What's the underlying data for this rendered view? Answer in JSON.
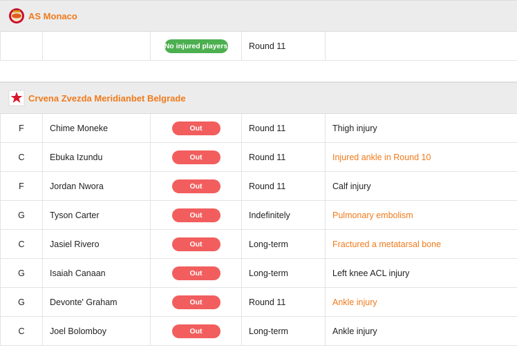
{
  "teams": [
    {
      "name": "AS Monaco",
      "logo_icon": "monaco-logo-icon",
      "rows": [
        {
          "pos": "",
          "player": "",
          "status": "No injured players",
          "status_type": "none",
          "timeline": "Round 11",
          "reason": "",
          "reason_link": false
        }
      ]
    },
    {
      "name": "Crvena Zvezda Meridianbet Belgrade",
      "logo_icon": "crvena-zvezda-logo-icon",
      "rows": [
        {
          "pos": "F",
          "player": "Chime Moneke",
          "status": "Out",
          "status_type": "out",
          "timeline": "Round 11",
          "reason": "Thigh injury",
          "reason_link": false
        },
        {
          "pos": "C",
          "player": "Ebuka Izundu",
          "status": "Out",
          "status_type": "out",
          "timeline": "Round 11",
          "reason": "Injured ankle in Round 10",
          "reason_link": true
        },
        {
          "pos": "F",
          "player": "Jordan Nwora",
          "status": "Out",
          "status_type": "out",
          "timeline": "Round 11",
          "reason": "Calf injury",
          "reason_link": false
        },
        {
          "pos": "G",
          "player": "Tyson Carter",
          "status": "Out",
          "status_type": "out",
          "timeline": "Indefinitely",
          "reason": "Pulmonary embolism",
          "reason_link": true
        },
        {
          "pos": "C",
          "player": "Jasiel Rivero",
          "status": "Out",
          "status_type": "out",
          "timeline": "Long-term",
          "reason": "Fractured a metatarsal bone",
          "reason_link": true
        },
        {
          "pos": "G",
          "player": "Isaiah Canaan",
          "status": "Out",
          "status_type": "out",
          "timeline": "Long-term",
          "reason": "Left knee ACL injury",
          "reason_link": false
        },
        {
          "pos": "G",
          "player": "Devonte' Graham",
          "status": "Out",
          "status_type": "out",
          "timeline": "Round 11",
          "reason": "Ankle injury",
          "reason_link": true
        },
        {
          "pos": "C",
          "player": "Joel Bolomboy",
          "status": "Out",
          "status_type": "out",
          "timeline": "Long-term",
          "reason": "Ankle injury",
          "reason_link": false
        }
      ]
    }
  ],
  "colors": {
    "accent": "#f07a1a",
    "out": "#f25e5e",
    "none": "#4caf50",
    "header_bg": "#ececec"
  }
}
